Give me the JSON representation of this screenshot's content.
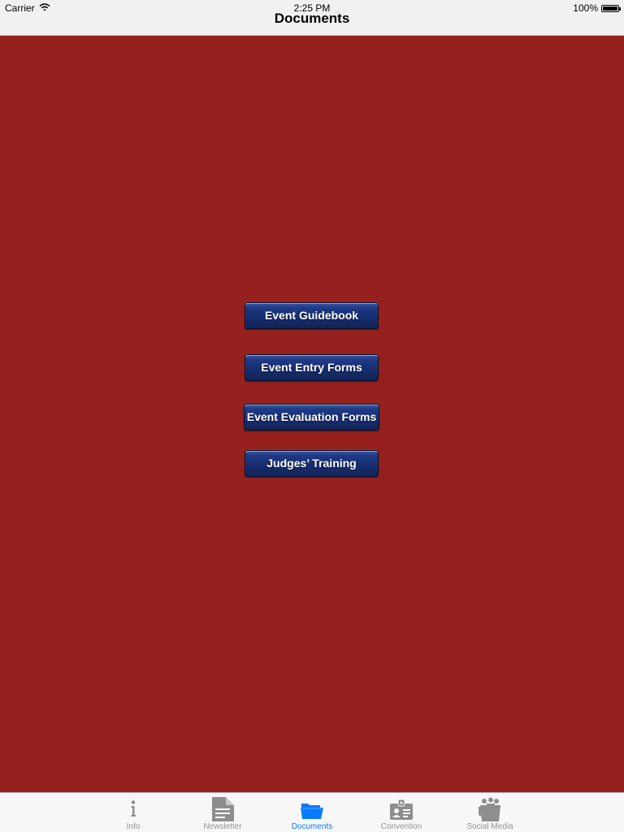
{
  "status_bar": {
    "carrier": "Carrier",
    "time": "2:25 PM",
    "battery": "100%",
    "battery_level": 1.0
  },
  "nav": {
    "title": "Documents"
  },
  "buttons": [
    {
      "label": "Event Guidebook"
    },
    {
      "label": "Event Entry Forms"
    },
    {
      "label": "Event Evaluation Forms"
    },
    {
      "label": "Judges’ Training"
    }
  ],
  "tabs": [
    {
      "label": "Info",
      "icon": "info-icon",
      "active": false
    },
    {
      "label": "Newsletter",
      "icon": "document-icon",
      "active": false
    },
    {
      "label": "Documents",
      "icon": "folder-icon",
      "active": true
    },
    {
      "label": "Convention",
      "icon": "id-badge-icon",
      "active": false
    },
    {
      "label": "Social Media",
      "icon": "people-icon",
      "active": false
    }
  ],
  "colors": {
    "background": "#96201d",
    "button": "#182f72",
    "active_tab": "#0a7aff",
    "inactive_tab": "#929292"
  }
}
